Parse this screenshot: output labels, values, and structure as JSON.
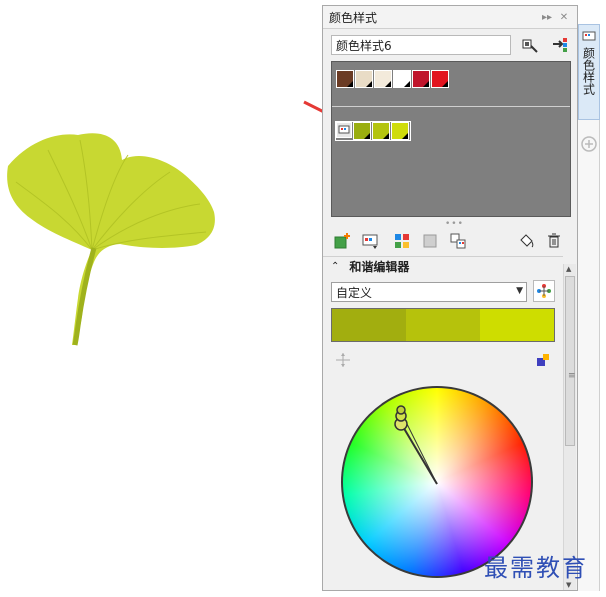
{
  "panel": {
    "title": "颜色样式",
    "side_tab_label": "颜色样式"
  },
  "style_name": {
    "value": "颜色样式6"
  },
  "palettes": [
    {
      "swatches": [
        "#6b3b24",
        "#e9dcc6",
        "#f3eadb",
        "#ffffff",
        "#c0152c",
        "#e2141f"
      ]
    },
    {
      "swatches": [
        "#9aae10",
        "#b4c40f",
        "#cfdc0b"
      ]
    }
  ],
  "harmony_editor": {
    "title": "和谐编辑器",
    "rule": "自定义",
    "strip_colors": [
      "#a2ae0f",
      "#b6c20c",
      "#cedd00"
    ]
  },
  "leaf": {
    "color": "#c8d832",
    "vein_color": "#b1c224",
    "stem_color": "#9fb21c"
  },
  "watermark": "最需教育"
}
